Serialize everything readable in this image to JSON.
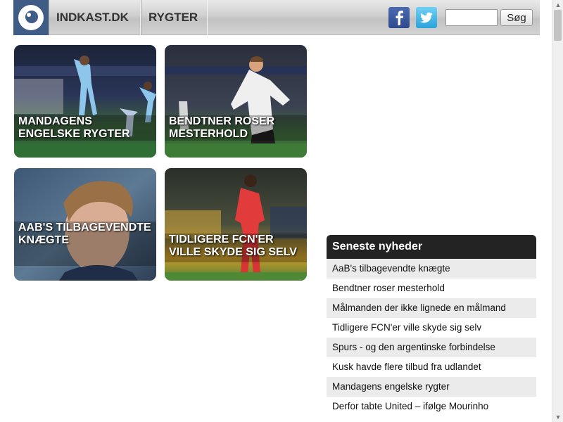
{
  "header": {
    "logo_icon": "indkast-logo-icon",
    "nav": [
      {
        "label": "INDKAST.DK"
      },
      {
        "label": "RYGTER"
      }
    ],
    "social": [
      {
        "icon": "facebook-icon"
      },
      {
        "icon": "twitter-icon"
      }
    ],
    "search": {
      "value": "",
      "placeholder": "",
      "button_label": "Søg"
    }
  },
  "tiles": [
    {
      "title": "MANDAGENS ENGELSKE RYGTER"
    },
    {
      "title": "BENDTNER ROSER MESTERHOLD"
    },
    {
      "title": "AAB'S TILBAGEVENDTE KNÆGTE"
    },
    {
      "title": "TIDLIGERE FCN'ER VILLE SKYDE SIG SELV"
    }
  ],
  "news": {
    "heading": "Seneste nyheder",
    "items": [
      {
        "label": "AaB's tilbagevendte knægte"
      },
      {
        "label": "Bendtner roser mesterhold"
      },
      {
        "label": "Målmanden der ikke lignede en målmand"
      },
      {
        "label": "Tidligere FCN'er ville skyde sig selv"
      },
      {
        "label": "Spurs - og den argentinske forbindelse"
      },
      {
        "label": "Kusk havde flere tilbud fra udlandet"
      },
      {
        "label": "Mandagens engelske rygter"
      },
      {
        "label": "Derfor tabte United – ifølge Mourinho"
      }
    ]
  },
  "colors": {
    "logo_bg": "#3f5c86",
    "news_header_bg": "#232323",
    "news_stripe": "#ebebeb"
  }
}
